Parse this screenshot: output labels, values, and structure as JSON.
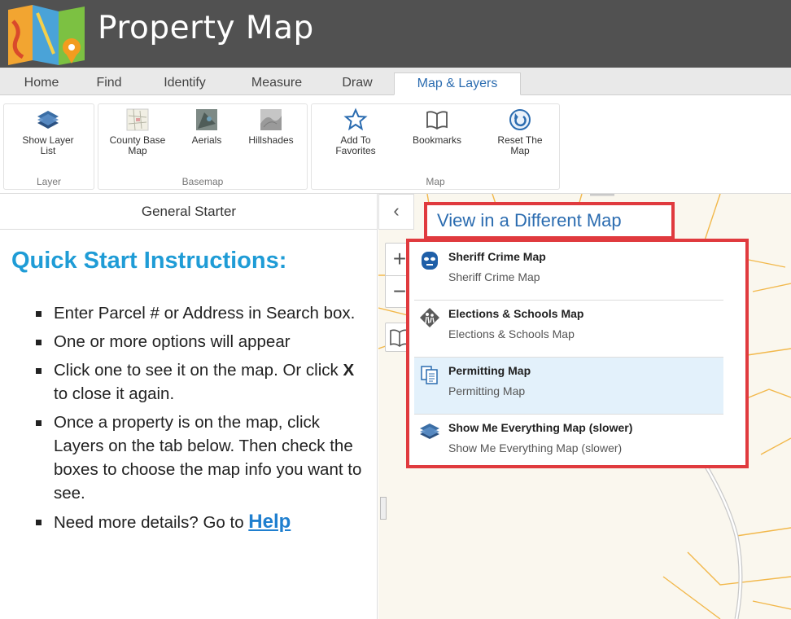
{
  "app": {
    "title": "Property Map"
  },
  "tabs": [
    "Home",
    "Find",
    "Identify",
    "Measure",
    "Draw",
    "Map & Layers"
  ],
  "ribbon": {
    "layer_group": {
      "label": "Layer",
      "buttons": [
        {
          "label1": "Show Layer",
          "label2": "List",
          "icon": "layers-icon"
        }
      ]
    },
    "basemap_group": {
      "label": "Basemap",
      "buttons": [
        {
          "label1": "County Base",
          "label2": "Map",
          "icon": "county-base-map-thumbnail"
        },
        {
          "label1": "Aerials",
          "label2": "",
          "icon": "aerials-thumbnail"
        },
        {
          "label1": "Hillshades",
          "label2": "",
          "icon": "hillshades-thumbnail"
        }
      ]
    },
    "map_group": {
      "label": "Map",
      "buttons": [
        {
          "label1": "Add To",
          "label2": "Favorites",
          "icon": "star-icon"
        },
        {
          "label1": "Bookmarks",
          "label2": "",
          "icon": "book-icon"
        },
        {
          "label1": "Reset The",
          "label2": "Map",
          "icon": "reset-icon"
        }
      ]
    }
  },
  "left_panel": {
    "header": "General Starter",
    "title": "Quick Start Instructions:",
    "items": [
      "Enter Parcel # or Address in Search box.",
      "One or more options will appear",
      {
        "pre": "Click one to see it on the map. Or click ",
        "bold": "X",
        "post": " to close it again."
      },
      "Once a property is on the map, click Layers on the tab below. Then check the boxes to choose the map info you want to see.",
      {
        "pre": "Need more details? Go to ",
        "link": "Help"
      }
    ]
  },
  "map": {
    "collapse_icon": "chevron-left-icon",
    "zoom_in": "+",
    "zoom_out": "−",
    "view_title": "View in a Different Map",
    "options": [
      {
        "title": "Sheriff Crime Map",
        "subtitle": "Sheriff Crime Map",
        "icon": "sheriff-mask-icon",
        "highlighted": false
      },
      {
        "title": "Elections & Schools Map",
        "subtitle": "Elections & Schools Map",
        "icon": "school-crossing-icon",
        "highlighted": false
      },
      {
        "title": "Permitting Map",
        "subtitle": "Permitting Map",
        "icon": "documents-icon",
        "highlighted": true
      },
      {
        "title": "Show Me Everything Map (slower)",
        "subtitle": "Show Me Everything Map (slower)",
        "icon": "layers-icon",
        "highlighted": false
      }
    ]
  },
  "colors": {
    "header_bg": "#515151",
    "accent": "#1f9cd6",
    "link": "#2b6cb0",
    "highlight_box": "#e03a3e",
    "selected_row": "#e3f1fb"
  }
}
